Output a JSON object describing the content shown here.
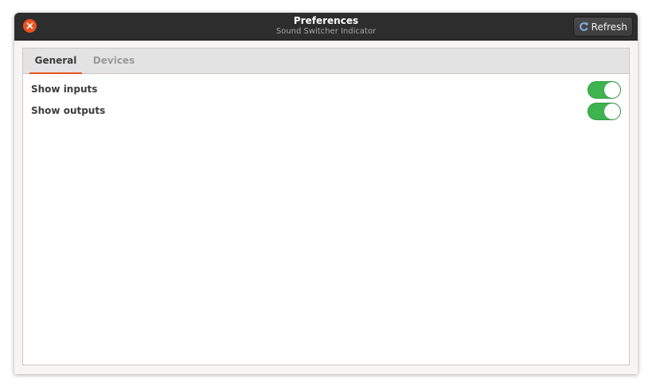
{
  "window": {
    "title": "Preferences",
    "subtitle": "Sound Switcher Indicator"
  },
  "headerbar": {
    "refresh_label": "Refresh",
    "refresh_icon": "refresh-icon",
    "close_icon": "close-icon"
  },
  "tabs": [
    {
      "label": "General",
      "active": true
    },
    {
      "label": "Devices",
      "active": false
    }
  ],
  "general": {
    "settings": [
      {
        "label": "Show inputs",
        "enabled": true
      },
      {
        "label": "Show outputs",
        "enabled": true
      }
    ]
  },
  "colors": {
    "accent": "#e95420",
    "switch_on": "#3eb34f",
    "headerbar": "#2d2d2d"
  }
}
